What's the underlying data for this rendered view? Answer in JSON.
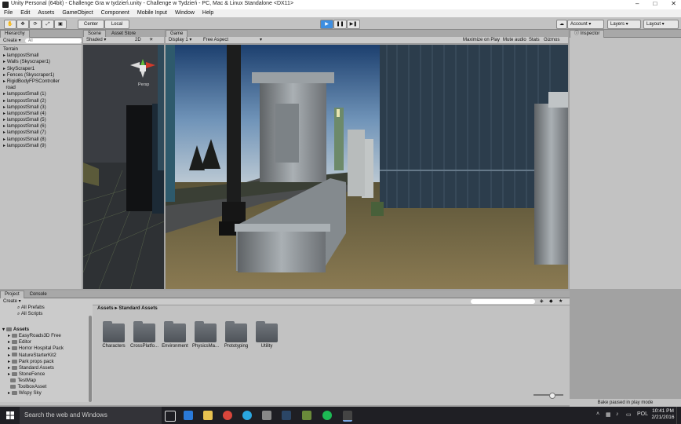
{
  "window": {
    "title": "Unity Personal (64bit) - Challenge Gra w tydzień.unity - Challenge w Tydzień - PC, Mac & Linux Standalone <DX11>",
    "controls": [
      "–",
      "□",
      "✕"
    ]
  },
  "menu": [
    "File",
    "Edit",
    "Assets",
    "GameObject",
    "Component",
    "Mobile Input",
    "Window",
    "Help"
  ],
  "toolbar": {
    "pivot": "Center",
    "space": "Local",
    "account": "Account",
    "layers": "Layers",
    "layout": "Layout"
  },
  "hierarchy": {
    "tab": "Hierarchy",
    "create": "Create",
    "search_placeholder": "All",
    "items": [
      "Terrain",
      "lamppostSmall",
      "Walls (Skyscraper1)",
      "SkyScraper1",
      "Fences (Skyscraper1)",
      "RigidBodyFPSController",
      "road",
      "lamppostSmall (1)",
      "lamppostSmall (2)",
      "lamppostSmall (3)",
      "lamppostSmall (4)",
      "lamppostSmall (5)",
      "lamppostSmall (6)",
      "lamppostSmall (7)",
      "lamppostSmall (8)",
      "lamppostSmall (9)"
    ]
  },
  "scene": {
    "tabs": [
      "Scene",
      "Asset Store"
    ],
    "shading": "Shaded",
    "mode2d": "2D",
    "gizmo_label": "Persp"
  },
  "game": {
    "tab": "Game",
    "display": "Display 1",
    "aspect": "Free Aspect",
    "options": [
      "Maximize on Play",
      "Mute audio",
      "Stats",
      "Gizmos"
    ]
  },
  "inspector": {
    "tab": "Inspector"
  },
  "project": {
    "tabs": [
      "Project",
      "Console"
    ],
    "create": "Create",
    "favorites": [
      "All Prefabs",
      "All Scripts"
    ],
    "assets_label": "Assets",
    "folders": [
      "EasyRoads3D Free",
      "Editor",
      "Horror Hospital Pack",
      "NatureStarterKit2",
      "Park props pack",
      "Standard Assets",
      "StoneFence",
      "TestMap",
      "ToolboxAsset",
      "Wispy Sky"
    ],
    "breadcrumb": [
      "Assets",
      "Standard Assets"
    ],
    "content_folders": [
      "Characters",
      "CrossPlatfo...",
      "Environment",
      "PhysicsMa...",
      "Prototyping",
      "Utility"
    ]
  },
  "statusbar": {
    "message": "Bake paused in play mode"
  },
  "taskbar": {
    "search": "Search the web and Windows",
    "lang": "POL",
    "time": "10:41 PM",
    "date": "2/21/2016"
  },
  "colors": {
    "accent_play": "#3e8ee0",
    "panel_bg": "#c2c2c2",
    "taskbar_bg": "#1f1f24"
  }
}
